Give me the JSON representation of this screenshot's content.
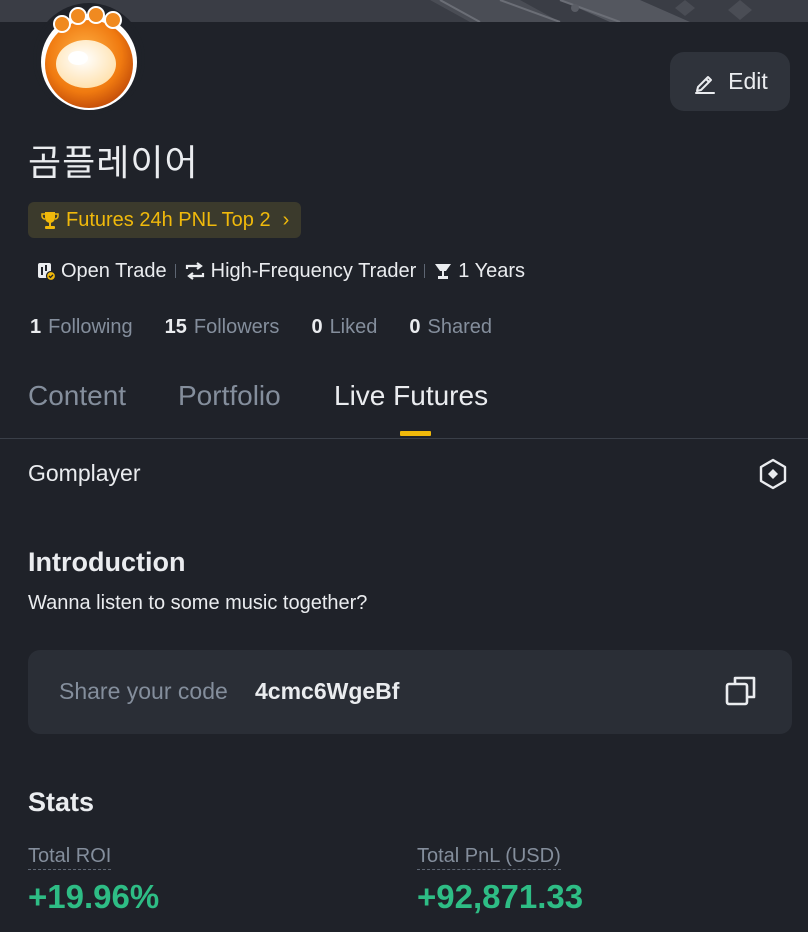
{
  "profile": {
    "username": "곰플레이어",
    "edit_label": "Edit",
    "badge_label": "Futures 24h PNL Top 2",
    "tags": [
      {
        "label": "Open Trade",
        "icon": "open-trade-icon"
      },
      {
        "label": "High-Frequency Trader",
        "icon": "repeat-icon"
      },
      {
        "label": "1 Years",
        "icon": "trophy-icon"
      }
    ],
    "social": {
      "following_count": "1",
      "following_label": "Following",
      "followers_count": "15",
      "followers_label": "Followers",
      "liked_count": "0",
      "liked_label": "Liked",
      "shared_count": "0",
      "shared_label": "Shared"
    }
  },
  "tabs": [
    {
      "label": "Content",
      "active": false
    },
    {
      "label": "Portfolio",
      "active": false
    },
    {
      "label": "Live Futures",
      "active": true
    }
  ],
  "section": {
    "name": "Gomplayer",
    "intro_title": "Introduction",
    "intro_text": "Wanna listen to some music together?",
    "share_label": "Share your code",
    "share_code": "4cmc6WgeBf"
  },
  "stats": {
    "title": "Stats",
    "roi_label": "Total ROI",
    "roi_value": "+19.96%",
    "pnl_label": "Total PnL (USD)",
    "pnl_value": "+92,871.33"
  },
  "colors": {
    "background": "#1f2229",
    "accent": "#f0b90b",
    "positive": "#2ebd85",
    "muted": "#848e9c"
  }
}
